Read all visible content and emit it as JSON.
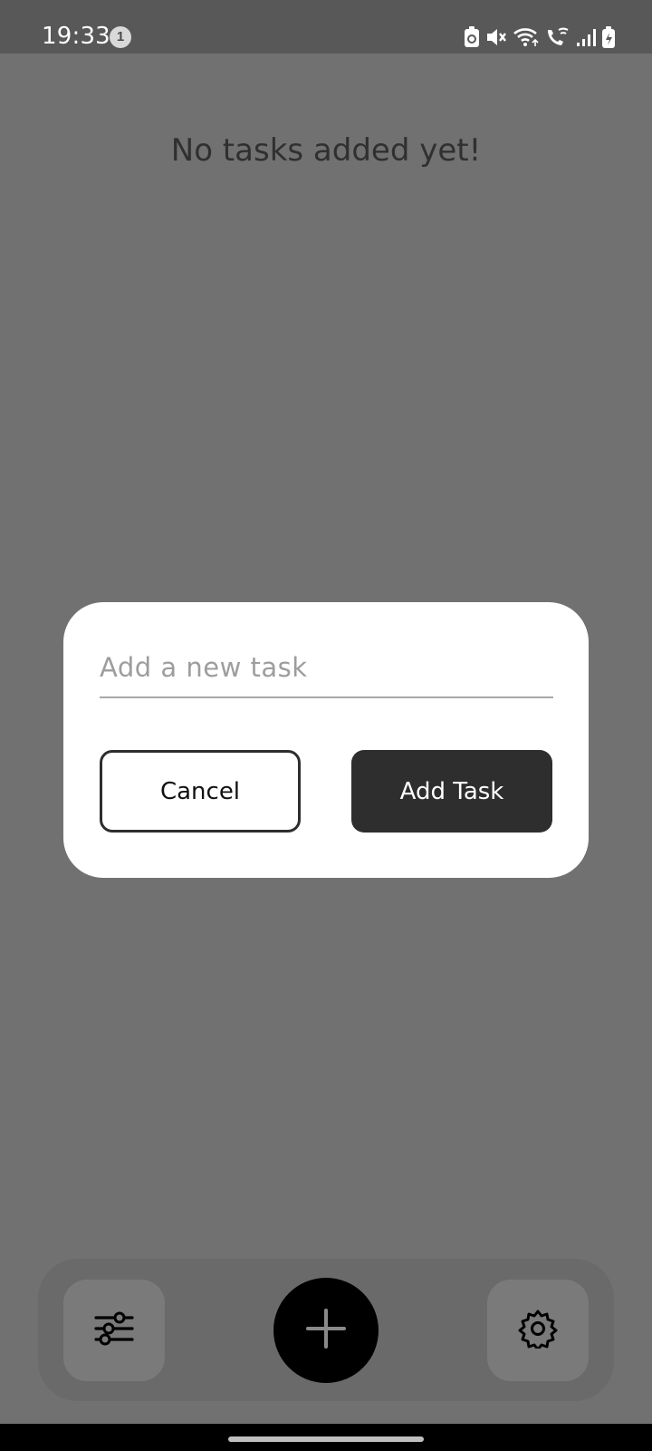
{
  "status_bar": {
    "time": "19:33",
    "notification_count": "1",
    "icons": [
      "recycle-battery-icon",
      "mute-icon",
      "wifi-icon",
      "wifi-calling-icon",
      "signal-icon",
      "battery-charging-icon"
    ]
  },
  "main": {
    "empty_message": "No tasks added yet!"
  },
  "dialog": {
    "input": {
      "value": "",
      "placeholder": "Add a new task"
    },
    "cancel_label": "Cancel",
    "add_label": "Add Task"
  },
  "bottom_nav": {
    "items": [
      {
        "icon": "sliders-icon"
      },
      {
        "icon": "plus-icon"
      },
      {
        "icon": "gear-icon"
      }
    ]
  },
  "colors": {
    "scrim": "#717171",
    "status_bar": "#585858",
    "dialog_bg": "#ffffff",
    "primary_button": "#2e2e2e",
    "fab": "#000000"
  }
}
